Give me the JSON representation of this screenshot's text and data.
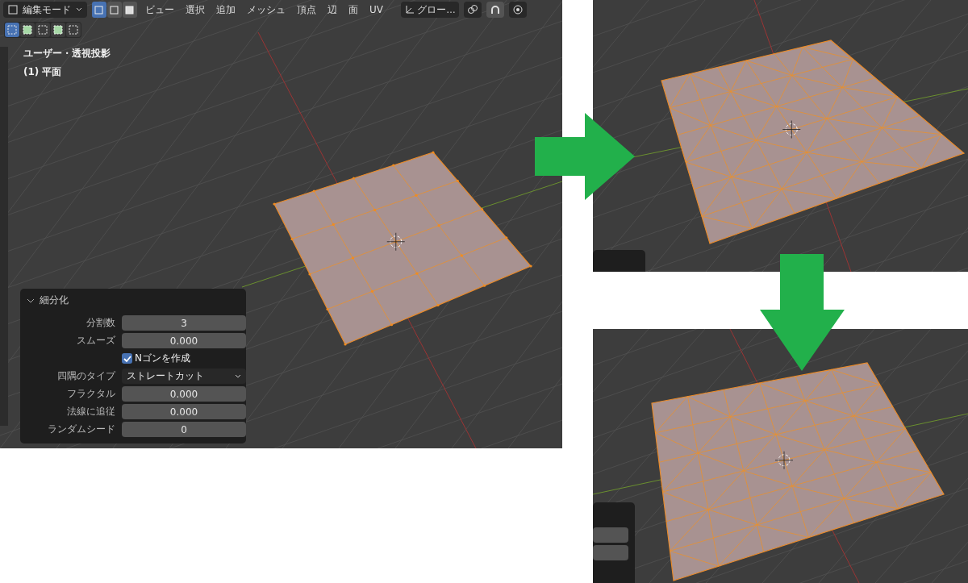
{
  "header": {
    "mode": "編集モード",
    "select_modes": [
      {
        "selected": true
      },
      {
        "selected": false
      },
      {
        "selected": false
      }
    ],
    "menus": [
      "ビュー",
      "選択",
      "追加",
      "メッシュ",
      "頂点",
      "辺",
      "面",
      "UV"
    ],
    "transform": "グロー…",
    "snapping_on": true
  },
  "select_tools": [
    {
      "selected": true
    },
    {
      "selected": false
    },
    {
      "selected": false
    },
    {
      "selected": false
    },
    {
      "selected": false
    }
  ],
  "viewport_info": [
    "ユーザー・透視投影",
    "(1) 平面"
  ],
  "operator_panel": {
    "title": "細分化",
    "expanded": true,
    "fields": [
      {
        "kind": "number",
        "label": "分割数",
        "value": "3"
      },
      {
        "kind": "number",
        "label": "スムーズ",
        "value": "0.000"
      },
      {
        "kind": "checkbox",
        "label": "Nゴンを作成",
        "checked": true
      },
      {
        "kind": "dropdown",
        "label": "四隅のタイプ",
        "value": "ストレートカット"
      },
      {
        "kind": "number",
        "label": "フラクタル",
        "value": "0.000"
      },
      {
        "kind": "number",
        "label": "法線に追従",
        "value": "0.000"
      },
      {
        "kind": "number",
        "label": "ランダムシード",
        "value": "0"
      }
    ]
  }
}
